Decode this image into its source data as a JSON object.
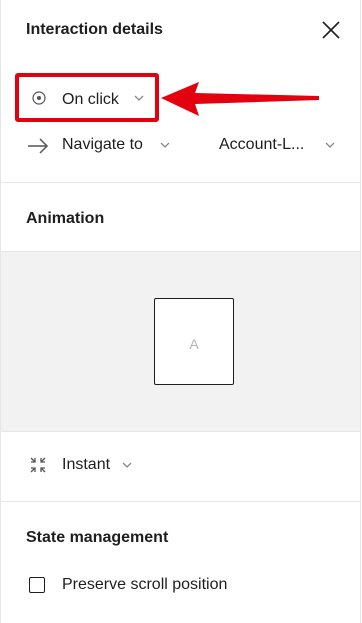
{
  "header": {
    "title": "Interaction details",
    "close_icon": "close-icon"
  },
  "trigger": {
    "label": "On click",
    "icon": "target-circle-icon"
  },
  "action": {
    "label": "Navigate to",
    "icon": "arrow-right-icon",
    "destination": "Account-L..."
  },
  "animation_section": {
    "title": "Animation",
    "preview_letter": "A"
  },
  "animation": {
    "label": "Instant",
    "icon": "collapse-arrows-icon"
  },
  "state_section": {
    "title": "State management"
  },
  "preserve_scroll": {
    "label": "Preserve scroll position",
    "checked": false
  },
  "colors": {
    "annotation_red": "#e3000f",
    "preview_bg": "#f2f2f2",
    "teal": "#0c7a7a"
  }
}
